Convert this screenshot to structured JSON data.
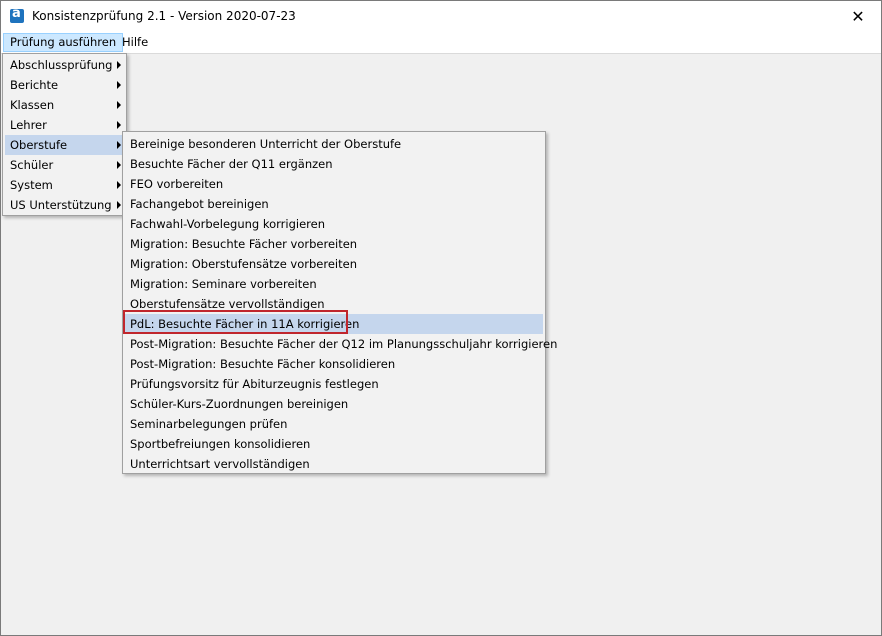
{
  "window": {
    "title": "Konsistenzprüfung 2.1 - Version 2020-07-23",
    "close_glyph": "✕"
  },
  "menubar": {
    "items": [
      {
        "label": "Prüfung ausführen"
      },
      {
        "label": "Hilfe"
      }
    ]
  },
  "main_menu": {
    "items": [
      {
        "label": "Abschlussprüfung"
      },
      {
        "label": "Berichte"
      },
      {
        "label": "Klassen"
      },
      {
        "label": "Lehrer"
      },
      {
        "label": "Oberstufe"
      },
      {
        "label": "Schüler"
      },
      {
        "label": "System"
      },
      {
        "label": "US Unterstützung"
      }
    ]
  },
  "submenu": {
    "items": [
      {
        "label": "Bereinige besonderen Unterricht der Oberstufe"
      },
      {
        "label": "Besuchte Fächer der Q11 ergänzen"
      },
      {
        "label": "FEO vorbereiten"
      },
      {
        "label": "Fachangebot bereinigen"
      },
      {
        "label": "Fachwahl-Vorbelegung korrigieren"
      },
      {
        "label": "Migration: Besuchte Fächer vorbereiten"
      },
      {
        "label": "Migration: Oberstufensätze vorbereiten"
      },
      {
        "label": "Migration: Seminare vorbereiten"
      },
      {
        "label": "Oberstufensätze vervollständigen"
      },
      {
        "label": "PdL: Besuchte Fächer in 11A korrigieren"
      },
      {
        "label": "Post-Migration: Besuchte Fächer der Q12 im Planungsschuljahr korrigieren"
      },
      {
        "label": "Post-Migration: Besuchte Fächer konsolidieren"
      },
      {
        "label": "Prüfungsvorsitz für Abiturzeugnis festlegen"
      },
      {
        "label": "Schüler-Kurs-Zuordnungen bereinigen"
      },
      {
        "label": "Seminarbelegungen prüfen"
      },
      {
        "label": "Sportbefreiungen konsolidieren"
      },
      {
        "label": "Unterrichtsart vervollständigen"
      }
    ]
  },
  "colors": {
    "highlight": "#c5d6ed",
    "callout_border": "#c0262d",
    "menubar_open": "#cce8ff"
  }
}
